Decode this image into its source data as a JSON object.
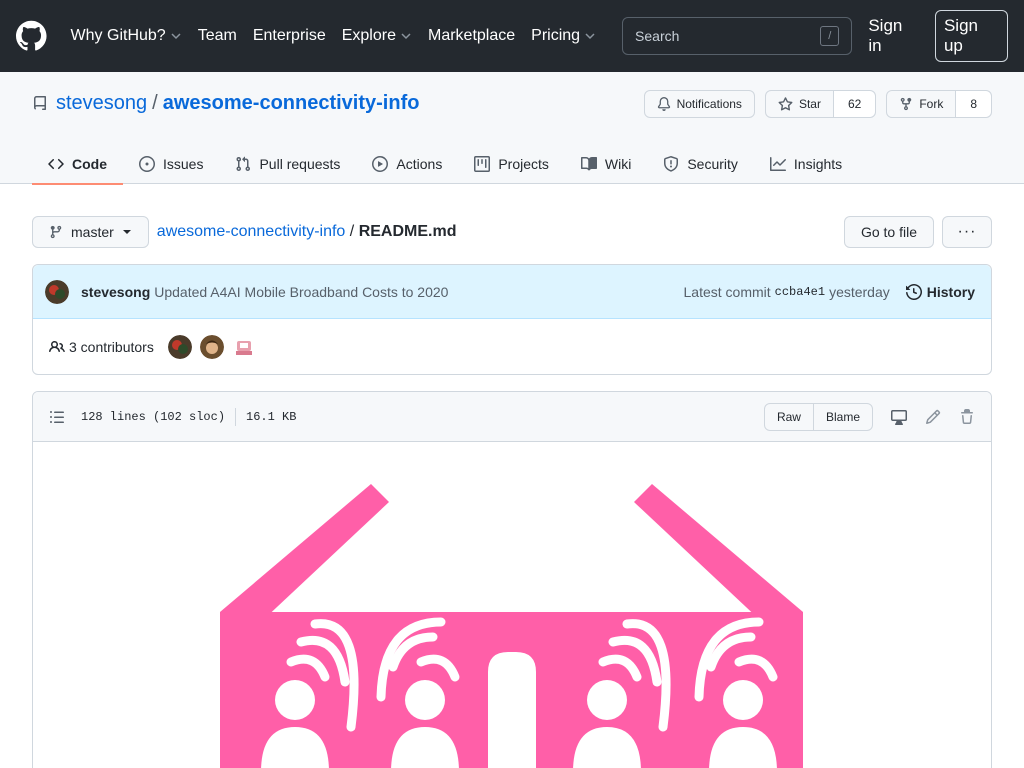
{
  "nav": {
    "items": [
      {
        "label": "Why GitHub?",
        "dropdown": true
      },
      {
        "label": "Team",
        "dropdown": false
      },
      {
        "label": "Enterprise",
        "dropdown": false
      },
      {
        "label": "Explore",
        "dropdown": true
      },
      {
        "label": "Marketplace",
        "dropdown": false
      },
      {
        "label": "Pricing",
        "dropdown": true
      }
    ],
    "search_placeholder": "Search",
    "search_shortcut": "/",
    "sign_in": "Sign in",
    "sign_up": "Sign up"
  },
  "repo": {
    "owner": "stevesong",
    "separator": "/",
    "name": "awesome-connectivity-info",
    "notifications_label": "Notifications",
    "star_label": "Star",
    "star_count": "62",
    "fork_label": "Fork",
    "fork_count": "8"
  },
  "tabs": [
    {
      "label": "Code",
      "active": true
    },
    {
      "label": "Issues",
      "active": false
    },
    {
      "label": "Pull requests",
      "active": false
    },
    {
      "label": "Actions",
      "active": false
    },
    {
      "label": "Projects",
      "active": false
    },
    {
      "label": "Wiki",
      "active": false
    },
    {
      "label": "Security",
      "active": false
    },
    {
      "label": "Insights",
      "active": false
    }
  ],
  "file_nav": {
    "branch": "master",
    "repo_link": "awesome-connectivity-info",
    "separator": "/",
    "file": "README.md",
    "go_to_file": "Go to file",
    "more": "···"
  },
  "commit": {
    "author": "stevesong",
    "message": "Updated A4AI Mobile Broadband Costs to 2020",
    "latest_label": "Latest commit",
    "sha": "ccba4e1",
    "time": "yesterday",
    "history_label": "History"
  },
  "contributors": {
    "label": "3 contributors"
  },
  "file_info": {
    "lines": "128 lines (102 sloc)",
    "size": "16.1 KB",
    "raw": "Raw",
    "blame": "Blame"
  },
  "colors": {
    "header_bg": "#24292f",
    "link": "#0969da",
    "tab_underline": "#fd8c73",
    "logo_pink": "#ff5fa8"
  }
}
